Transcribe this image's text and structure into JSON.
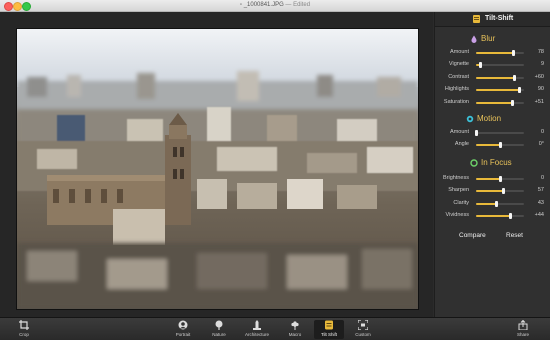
{
  "window": {
    "title": "_1000841.JPG",
    "edited": "Edited"
  },
  "panel": {
    "title": "Tilt-Shift",
    "sections": [
      {
        "title": "Blur",
        "icon": "drop-icon",
        "rows": [
          {
            "label": "Amount",
            "value": "78",
            "level": 0.78
          },
          {
            "label": "Vignette",
            "value": "9",
            "level": 0.09
          },
          {
            "label": "Contrast",
            "value": "+60",
            "level": 0.8
          },
          {
            "label": "Highlights",
            "value": "90",
            "level": 0.9
          },
          {
            "label": "Saturation",
            "value": "+51",
            "level": 0.76
          }
        ]
      },
      {
        "title": "Motion",
        "icon": "motion-icon",
        "rows": [
          {
            "label": "Amount",
            "value": "0",
            "level": 0.0
          },
          {
            "label": "Angle",
            "value": "0°",
            "level": 0.5
          }
        ]
      },
      {
        "title": "In Focus",
        "icon": "focus-ring-icon",
        "rows": [
          {
            "label": "Brightness",
            "value": "0",
            "level": 0.5
          },
          {
            "label": "Sharpen",
            "value": "57",
            "level": 0.57
          },
          {
            "label": "Clarity",
            "value": "43",
            "level": 0.43
          },
          {
            "label": "Vividness",
            "value": "+44",
            "level": 0.72
          }
        ]
      }
    ],
    "compare_label": "Compare",
    "reset_label": "Reset"
  },
  "toolbar": {
    "crop": "Crop",
    "portrait": "Portrait",
    "nature": "Nature",
    "architecture": "Architecture",
    "macro": "Macro",
    "tiltshift": "Tilt Shift",
    "custom": "Custom",
    "share": "Share"
  },
  "colors": {
    "accent": "#e8b93a",
    "section_title": "#e8c25a",
    "panel_bg": "#303030",
    "toolbar_bg": "#2f2f2f"
  }
}
